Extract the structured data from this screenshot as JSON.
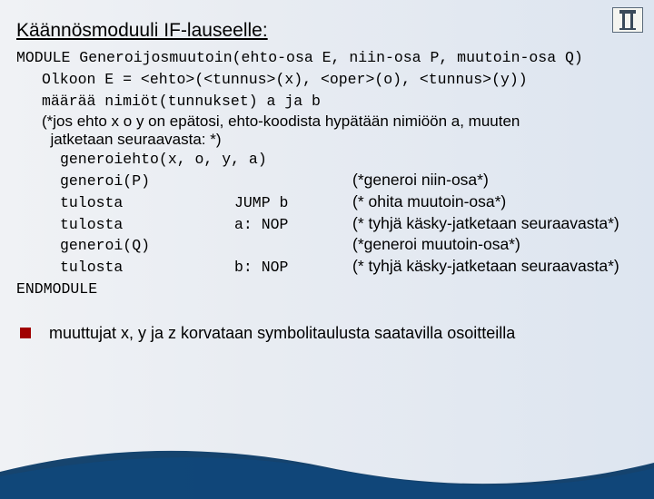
{
  "title": "Käännösmoduuli IF-lauseelle:",
  "module_header": "MODULE Generoijosmuutoin(ehto-osa E, niin-osa P, muutoin-osa Q)",
  "line_olkoon": "Olkoon E = <ehto>(<tunnus>(x), <oper>(o), <tunnus>(y))",
  "line_maaraa": "määrää nimiöt(tunnukset) a ja b",
  "note_star": "(*jos ehto x o y on epätosi, ehto-koodista hypätään nimiöön a, muuten jatketaan seuraavasta: *)",
  "line_generoiehto": "generoiehto(x, o, y, a)",
  "rows": [
    {
      "a": "generoi(P)",
      "b": "",
      "c": "(*generoi niin-osa*)"
    },
    {
      "a": "tulosta",
      "b": "JUMP b",
      "c": "(* ohita muutoin-osa*)"
    },
    {
      "a": "tulosta",
      "b": "a: NOP",
      "c": "(* tyhjä käsky-jatketaan seuraavasta*)"
    },
    {
      "a": "generoi(Q)",
      "b": "",
      "c": "(*generoi muutoin-osa*)"
    },
    {
      "a": "tulosta",
      "b": "b: NOP",
      "c": "(* tyhjä käsky-jatketaan seuraavasta*)"
    }
  ],
  "endmodule": "ENDMODULE",
  "bullet_text": "muuttujat x, y ja z korvataan symbolitaulusta saatavilla osoitteilla"
}
